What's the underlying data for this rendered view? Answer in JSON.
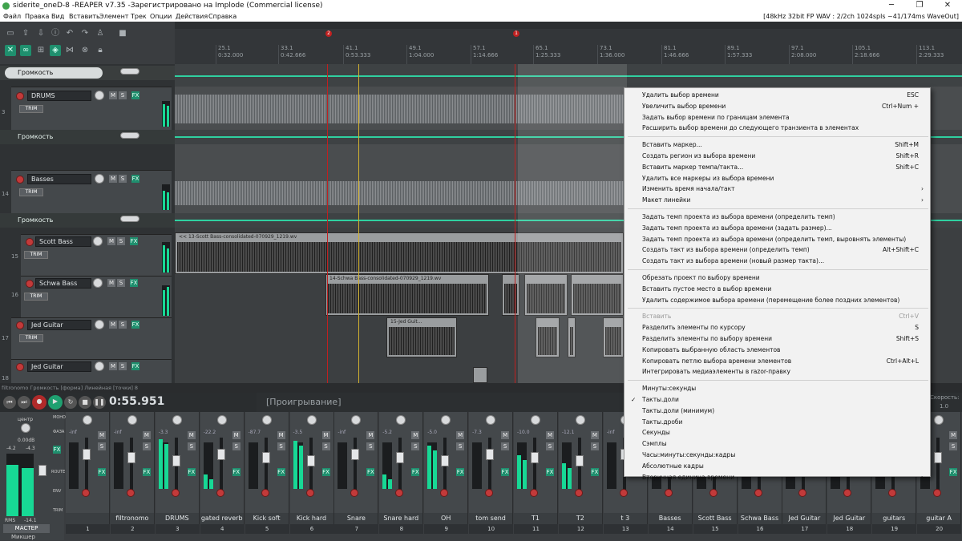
{
  "window": {
    "title": "siderite_oneD-8 -REAPER v7.35 -Зарегистрировано на Implode (Commercial license)",
    "status": "[48kHz 32bit FP WAV : 2/2ch 1024spls ~41/174ms WaveOut]",
    "min": "─",
    "max": "❐",
    "close": "✕"
  },
  "menu": [
    "Файл",
    "Правка",
    "Вид",
    "Вставить",
    "Элемент",
    "Трек",
    "Опции",
    "Действия",
    "Справка"
  ],
  "ruler": [
    {
      "bar": "25.1",
      "time": "0:32.000"
    },
    {
      "bar": "33.1",
      "time": "0:42.666"
    },
    {
      "bar": "41.1",
      "time": "0:53.333"
    },
    {
      "bar": "49.1",
      "time": "1:04.000"
    },
    {
      "bar": "57.1",
      "time": "1:14.666"
    },
    {
      "bar": "65.1",
      "time": "1:25.333"
    },
    {
      "bar": "73.1",
      "time": "1:36.000"
    },
    {
      "bar": "81.1",
      "time": "1:46.666"
    },
    {
      "bar": "89.1",
      "time": "1:57.333"
    },
    {
      "bar": "97.1",
      "time": "2:08.000"
    },
    {
      "bar": "105.1",
      "time": "2:18.666"
    },
    {
      "bar": "113.1",
      "time": "2:29.333"
    }
  ],
  "markers": [
    "2",
    "1"
  ],
  "tracks": {
    "env1": "Громкость",
    "drums": "DRUMS",
    "drums_num": "3",
    "env2": "Громкость",
    "basses": "Basses",
    "basses_num": "14",
    "env3": "Громкость",
    "scott": "Scott Bass",
    "scott_num": "15",
    "schwa": "Schwa Bass",
    "schwa_num": "16",
    "jed1": "Jed Guitar",
    "jed1_num": "17",
    "jed2": "Jed Guitar",
    "jed2_num": "18",
    "trim": "TRIM",
    "m": "M",
    "s": "S",
    "fx": "FX"
  },
  "items": {
    "scott": "<< 13-Scott Bass-consolidated-070929_1219.wv",
    "schwa": "14-Schwa Bass-consolidated-070929_1219.wv",
    "jed": "15-Jed Guit..."
  },
  "envbar": "filtronomo Громкость [форма] Линейная [точки] 8",
  "transport": {
    "time": "0:55.951",
    "state": "[Проигрывание]",
    "speed_label": "Скорость:",
    "speed": "1.0"
  },
  "mixer": {
    "master_label": "МАСТЕР",
    "master_db": "0.00dB",
    "center": "центр",
    "master_l": "-4.2",
    "master_r": "-4.3",
    "rms": "RMS",
    "rms_val": "-14.1",
    "strips": [
      {
        "name": "",
        "num": "1",
        "db": "-inf"
      },
      {
        "name": "filtronomo",
        "num": "2",
        "db": "-inf"
      },
      {
        "name": "DRUMS",
        "num": "3",
        "db": "-3.3"
      },
      {
        "name": "gated reverb",
        "num": "4",
        "db": "-22.2"
      },
      {
        "name": "Kick soft",
        "num": "5",
        "db": "-87.7"
      },
      {
        "name": "Kick hard",
        "num": "6",
        "db": "-3.5"
      },
      {
        "name": "Snare",
        "num": "7",
        "db": "-inf"
      },
      {
        "name": "Snare hard",
        "num": "8",
        "db": "-5.2"
      },
      {
        "name": "OH",
        "num": "9",
        "db": "-5.0"
      },
      {
        "name": "tom send",
        "num": "10",
        "db": "-7.3"
      },
      {
        "name": "T1",
        "num": "11",
        "db": "-10.0"
      },
      {
        "name": "T2",
        "num": "12",
        "db": "-12.1"
      },
      {
        "name": "t 3",
        "num": "13",
        "db": "-inf"
      },
      {
        "name": "Basses",
        "num": "14",
        "db": ""
      },
      {
        "name": "Scott Bass",
        "num": "15",
        "db": ""
      },
      {
        "name": "Schwa Bass",
        "num": "16",
        "db": ""
      },
      {
        "name": "Jed Guitar",
        "num": "17",
        "db": ""
      },
      {
        "name": "Jed Guitar",
        "num": "18",
        "db": ""
      },
      {
        "name": "guitars",
        "num": "19",
        "db": ""
      },
      {
        "name": "guitar A",
        "num": "20",
        "db": ""
      }
    ],
    "tab": "Микшер",
    "side": [
      "МОНО",
      "ФАЗА",
      "FX",
      "ROUTE",
      "ENV",
      "TRIM"
    ]
  },
  "context_menu": [
    {
      "label": "Удалить выбор времени",
      "shortcut": "ESC"
    },
    {
      "label": "Увеличить выбор времени",
      "shortcut": "Ctrl+Num +"
    },
    {
      "label": "Задать выбор времени по границам элемента",
      "shortcut": ""
    },
    {
      "label": "Расширить выбор времени до следующего транзиента в элементах",
      "shortcut": ""
    },
    {
      "sep": true
    },
    {
      "label": "Вставить маркер...",
      "shortcut": "Shift+M"
    },
    {
      "label": "Создать регион из выбора времени",
      "shortcut": "Shift+R"
    },
    {
      "label": "Вставить маркер темпа/такта...",
      "shortcut": "Shift+C"
    },
    {
      "label": "Удалить все маркеры из выбора времени",
      "shortcut": ""
    },
    {
      "label": "Изменить время начала/такт",
      "shortcut": "",
      "arrow": "›"
    },
    {
      "label": "Макет линейки",
      "shortcut": "",
      "arrow": "›"
    },
    {
      "sep": true
    },
    {
      "label": "Задать темп проекта из выбора времени (определить темп)",
      "shortcut": ""
    },
    {
      "label": "Задать темп проекта из выбора времени (задать размер)...",
      "shortcut": ""
    },
    {
      "label": "Задать темп проекта из выбора времени (определить темп, выровнять элементы)",
      "shortcut": ""
    },
    {
      "label": "Создать такт из выбора времени (определить темп)",
      "shortcut": "Alt+Shift+C"
    },
    {
      "label": "Создать такт из выбора времени (новый размер такта)...",
      "shortcut": ""
    },
    {
      "sep": true
    },
    {
      "label": "Обрезать проект по выбору времени",
      "shortcut": ""
    },
    {
      "label": "Вставить пустое место в выбор времени",
      "shortcut": ""
    },
    {
      "label": "Удалить содержимое выбора времени (перемещение более поздних элементов)",
      "shortcut": ""
    },
    {
      "sep": true
    },
    {
      "label": "Вставить",
      "shortcut": "Ctrl+V",
      "disabled": true
    },
    {
      "label": "Разделить элементы по курсору",
      "shortcut": "S"
    },
    {
      "label": "Разделить элементы по выбору времени",
      "shortcut": "Shift+S"
    },
    {
      "label": "Копировать выбранную область элементов",
      "shortcut": ""
    },
    {
      "label": "Копировать петлю выбора времени элементов",
      "shortcut": "Ctrl+Alt+L"
    },
    {
      "label": "Интегрировать медиаэлементы в razor-правку",
      "shortcut": ""
    },
    {
      "sep": true
    },
    {
      "label": "Минуты:секунды",
      "shortcut": ""
    },
    {
      "label": "Такты.доли",
      "shortcut": "",
      "check": "✓"
    },
    {
      "label": "Такты.доли (минимум)",
      "shortcut": ""
    },
    {
      "label": "Такты.дроби",
      "shortcut": ""
    },
    {
      "label": "Секунды",
      "shortcut": ""
    },
    {
      "label": "Сэмплы",
      "shortcut": ""
    },
    {
      "label": "Часы:минуты:секунды:кадры",
      "shortcut": ""
    },
    {
      "label": "Абсолютные кадры",
      "shortcut": ""
    },
    {
      "label": "Вторичная единица времени",
      "shortcut": "",
      "arrow": "›"
    }
  ]
}
